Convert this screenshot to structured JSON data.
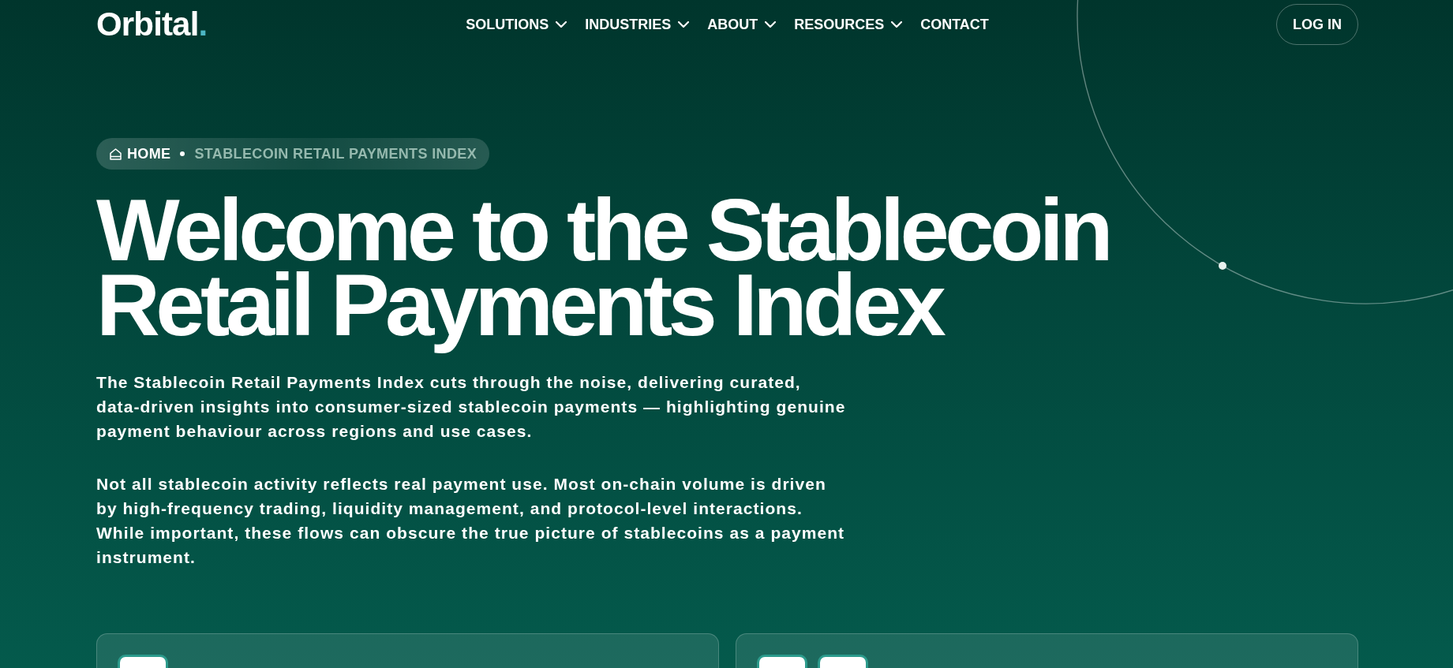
{
  "header": {
    "logo": {
      "text": "Orbital",
      "mark": "."
    },
    "nav": [
      {
        "label": "SOLUTIONS",
        "has_menu": true
      },
      {
        "label": "INDUSTRIES",
        "has_menu": true
      },
      {
        "label": "ABOUT",
        "has_menu": true
      },
      {
        "label": "RESOURCES",
        "has_menu": true
      },
      {
        "label": "CONTACT",
        "has_menu": false
      }
    ],
    "login_button": "LOG IN"
  },
  "breadcrumb": [
    {
      "label": "HOME",
      "kind": "home",
      "current": false
    },
    {
      "label": "STABLECOIN RETAIL PAYMENTS INDEX",
      "kind": "page",
      "current": true
    }
  ],
  "hero": {
    "title": "Welcome to the Stablecoin Retail Payments Index",
    "paragraphs": [
      "The Stablecoin Retail Payments Index cuts through the noise, delivering curated, data-driven insights into consumer-sized stablecoin payments — highlighting genuine payment behaviour across regions and use cases.",
      "Not all stablecoin activity reflects real payment use. Most on-chain volume is driven by high-frequency trading, liquidity management, and protocol-level interactions. While important, these flows can obscure the true picture of stablecoins as a payment instrument."
    ]
  },
  "cards": [
    {
      "tiles": [
        {
          "kind": "icon"
        }
      ]
    },
    {
      "tiles": [
        {
          "kind": "icon"
        },
        {
          "kind": "icon"
        }
      ]
    }
  ]
}
